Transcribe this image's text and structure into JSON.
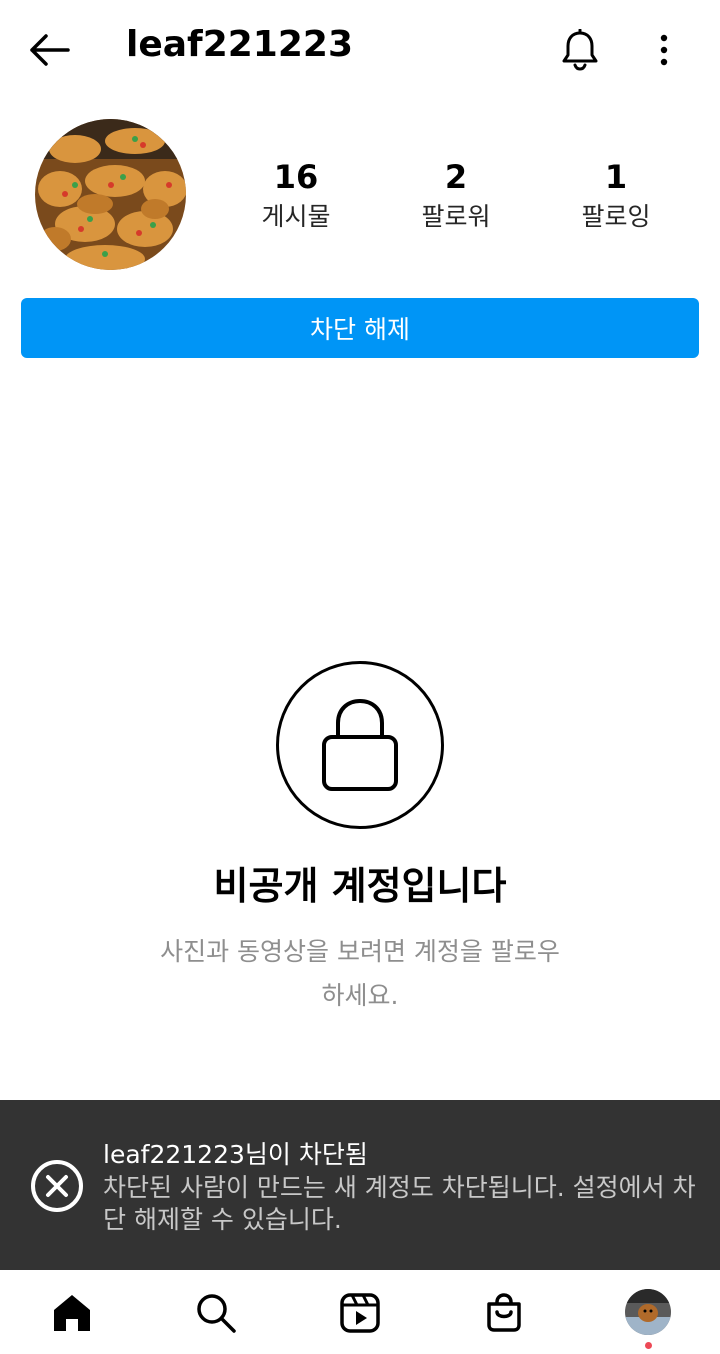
{
  "header": {
    "username": "leaf221223"
  },
  "profile": {
    "stats": [
      {
        "value": "16",
        "label": "게시물"
      },
      {
        "value": "2",
        "label": "팔로워"
      },
      {
        "value": "1",
        "label": "팔로잉"
      }
    ],
    "unblock_label": "차단 해제"
  },
  "private_notice": {
    "title": "비공개 계정입니다",
    "description": "사진과 동영상을 보려면 계정을 팔로우하세요."
  },
  "toast": {
    "title": "leaf221223님이 차단됨",
    "body": "차단된 사람이 만드는 새 계정도 차단됩니다. 설정에서 차단 해제할 수 있습니다."
  },
  "colors": {
    "accent": "#0095f6",
    "toast_bg": "#333333",
    "notification_dot": "#ed4956"
  },
  "icons": {
    "back": "arrow-left-icon",
    "bell": "bell-icon",
    "more": "more-vertical-icon",
    "lock": "lock-icon",
    "toast": "close-circle-icon",
    "nav": [
      "home-icon",
      "search-icon",
      "reels-icon",
      "shop-icon",
      "profile-avatar"
    ]
  }
}
